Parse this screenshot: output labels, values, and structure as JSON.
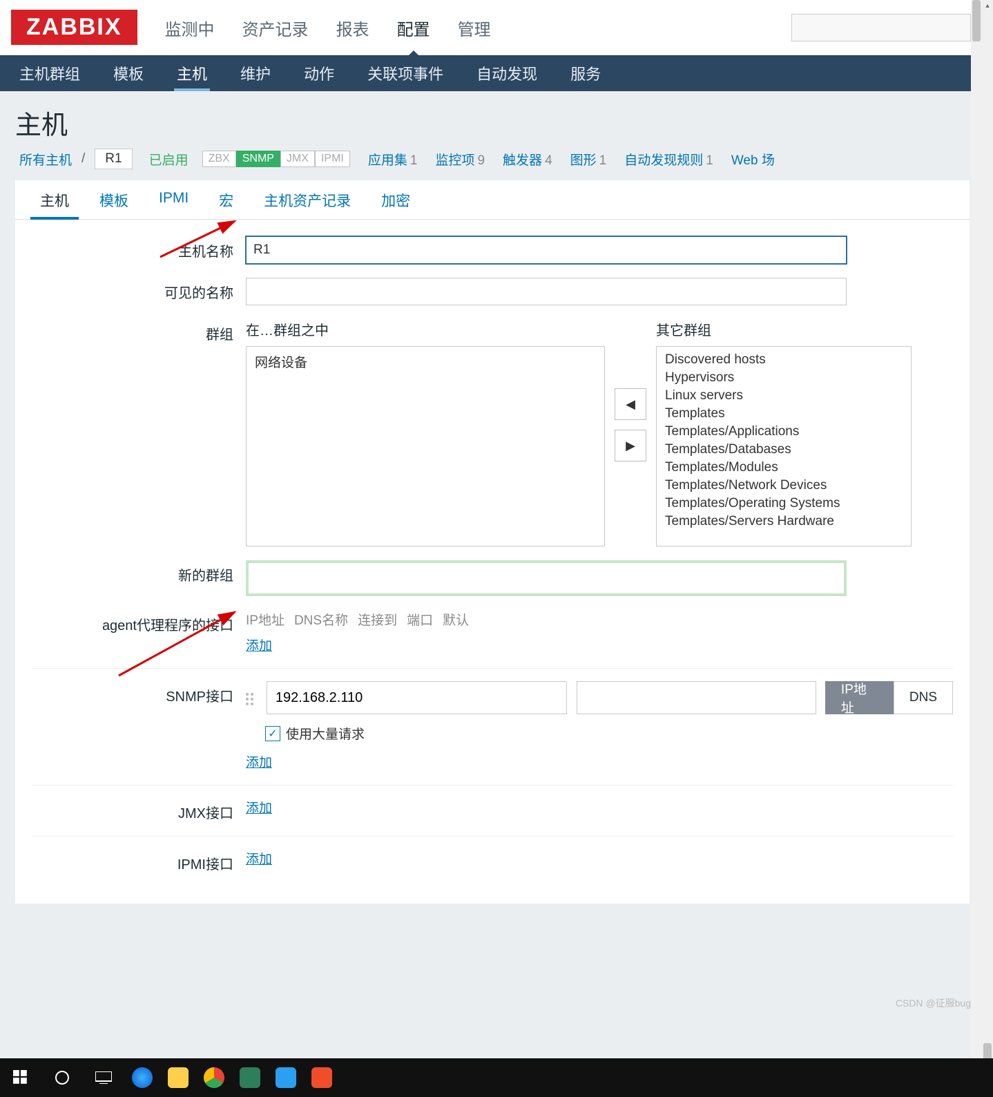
{
  "brand": "ZABBIX",
  "top_menu": [
    "监测中",
    "资产记录",
    "报表",
    "配置",
    "管理"
  ],
  "top_menu_active_index": 3,
  "sub_menu": [
    "主机群组",
    "模板",
    "主机",
    "维护",
    "动作",
    "关联项事件",
    "自动发现",
    "服务"
  ],
  "sub_menu_active_index": 2,
  "page_title": "主机",
  "breadcrumb": {
    "all_hosts": "所有主机",
    "host": "R1",
    "enabled": "已启用",
    "badges": [
      "ZBX",
      "SNMP",
      "JMX",
      "IPMI"
    ],
    "badge_active_index": 1,
    "counters": [
      {
        "label": "应用集",
        "value": "1"
      },
      {
        "label": "监控项",
        "value": "9"
      },
      {
        "label": "触发器",
        "value": "4"
      },
      {
        "label": "图形",
        "value": "1"
      },
      {
        "label": "自动发现规则",
        "value": "1"
      },
      {
        "label": "Web 场",
        "value": ""
      }
    ]
  },
  "tabs": [
    "主机",
    "模板",
    "IPMI",
    "宏",
    "主机资产记录",
    "加密"
  ],
  "tabs_active_index": 0,
  "form": {
    "host_name_label": "主机名称",
    "host_name_value": "R1",
    "visible_name_label": "可见的名称",
    "visible_name_value": "",
    "groups_label": "群组",
    "in_groups_label": "在…群组之中",
    "other_groups_label": "其它群组",
    "in_groups": [
      "网络设备"
    ],
    "other_groups": [
      "Discovered hosts",
      "Hypervisors",
      "Linux servers",
      "Templates",
      "Templates/Applications",
      "Templates/Databases",
      "Templates/Modules",
      "Templates/Network Devices",
      "Templates/Operating Systems",
      "Templates/Servers Hardware"
    ],
    "new_group_label": "新的群组",
    "new_group_value": "",
    "agent_interface_label": "agent代理程序的接口",
    "if_headers": [
      "IP地址",
      "DNS名称",
      "连接到",
      "端口",
      "默认"
    ],
    "add_label": "添加",
    "snmp_label": "SNMP接口",
    "snmp_ip": "192.168.2.110",
    "snmp_dns": "",
    "connect_ip": "IP地址",
    "connect_dns": "DNS",
    "bulk_label": "使用大量请求",
    "jmx_label": "JMX接口",
    "ipmi_label": "IPMI接口"
  },
  "watermark": "CSDN @征服bug"
}
